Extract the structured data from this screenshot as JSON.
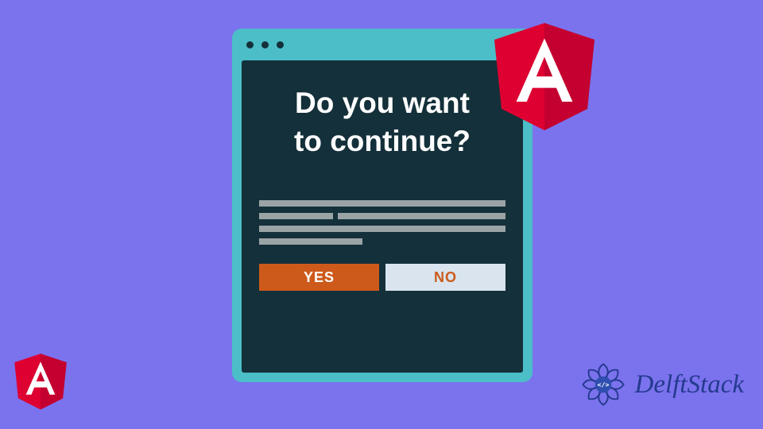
{
  "dialog": {
    "prompt_line1": "Do you want",
    "prompt_line2": "to continue?",
    "yes_label": "YES",
    "no_label": "NO"
  },
  "logos": {
    "angular_letter": "A",
    "delftstack": "DelftStack"
  },
  "colors": {
    "background": "#7b72ed",
    "titlebar": "#4bbec8",
    "window_body": "#14303a",
    "yes_button": "#cd5a1a",
    "no_button_bg": "#d9e4ee",
    "angular_red": "#dd0031",
    "angular_dark": "#c3002f",
    "delft_blue": "#243a8f"
  }
}
